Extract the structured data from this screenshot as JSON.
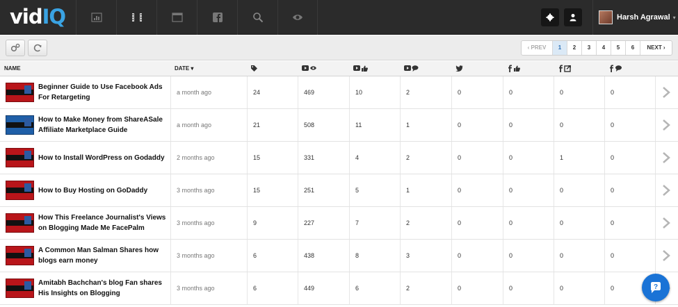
{
  "app": {
    "logo_part1": "vid",
    "logo_part2": "IQ"
  },
  "nav": {
    "tabs": [
      {
        "icon": "bar-chart-icon"
      },
      {
        "icon": "film-icon"
      },
      {
        "icon": "window-icon"
      },
      {
        "icon": "facebook-icon"
      },
      {
        "icon": "search-icon"
      },
      {
        "icon": "eye-icon"
      }
    ],
    "settings_icon": "gear-icon",
    "user_icon": "person-icon",
    "user_name": "Harsh Agrawal",
    "caret": "▾"
  },
  "toolbar": {
    "settings_icon": "cogs-icon",
    "refresh_icon": "refresh-icon",
    "pager": {
      "prev": "‹ PREV",
      "pages": [
        "1",
        "2",
        "3",
        "4",
        "5",
        "6"
      ],
      "active_page": "1",
      "next": "NEXT ›"
    }
  },
  "table": {
    "headers": {
      "name": "NAME",
      "date": "DATE ▾",
      "tags_icon": "tag-icon",
      "views_icon": "youtube-views-icon",
      "likes_icon": "youtube-likes-icon",
      "comments_icon": "youtube-comments-icon",
      "twitter_icon": "twitter-icon",
      "fb_likes_icon": "facebook-likes-icon",
      "fb_shares_icon": "facebook-shares-icon",
      "fb_comments_icon": "facebook-comments-icon"
    },
    "rows": [
      {
        "title": "Beginner Guide to Use Facebook Ads For Retargeting",
        "date": "a month ago",
        "tags": "24",
        "views": "469",
        "likes": "10",
        "comments": "2",
        "twitter": "0",
        "fb_likes": "0",
        "fb_shares": "0",
        "fb_comments": "0",
        "thumb": "red"
      },
      {
        "title": "How to Make Money from ShareASale Affiliate Marketplace Guide",
        "date": "a month ago",
        "tags": "21",
        "views": "508",
        "likes": "11",
        "comments": "1",
        "twitter": "0",
        "fb_likes": "0",
        "fb_shares": "0",
        "fb_comments": "0",
        "thumb": "blue"
      },
      {
        "title": "How to Install WordPress on Godaddy",
        "date": "2 months ago",
        "tags": "15",
        "views": "331",
        "likes": "4",
        "comments": "2",
        "twitter": "0",
        "fb_likes": "0",
        "fb_shares": "1",
        "fb_comments": "0",
        "thumb": "red"
      },
      {
        "title": "How to Buy Hosting on GoDaddy",
        "date": "3 months ago",
        "tags": "15",
        "views": "251",
        "likes": "5",
        "comments": "1",
        "twitter": "0",
        "fb_likes": "0",
        "fb_shares": "0",
        "fb_comments": "0",
        "thumb": "red"
      },
      {
        "title": "How This Freelance Journalist's Views on Blogging Made Me FacePalm",
        "date": "3 months ago",
        "tags": "9",
        "views": "227",
        "likes": "7",
        "comments": "2",
        "twitter": "0",
        "fb_likes": "0",
        "fb_shares": "0",
        "fb_comments": "0",
        "thumb": "red"
      },
      {
        "title": "A Common Man Salman Shares how blogs earn money",
        "date": "3 months ago",
        "tags": "6",
        "views": "438",
        "likes": "8",
        "comments": "3",
        "twitter": "0",
        "fb_likes": "0",
        "fb_shares": "0",
        "fb_comments": "0",
        "thumb": "red"
      },
      {
        "title": "Amitabh Bachchan's blog Fan shares His Insights on Blogging",
        "date": "3 months ago",
        "tags": "6",
        "views": "449",
        "likes": "6",
        "comments": "2",
        "twitter": "0",
        "fb_likes": "0",
        "fb_shares": "0",
        "fb_comments": "0",
        "thumb": "red"
      }
    ]
  },
  "help_icon": "chat-help-icon",
  "colors": {
    "brand": "#3aa3e3",
    "nav_bg": "#2b2b2b",
    "help_bg": "#1a73d6"
  }
}
